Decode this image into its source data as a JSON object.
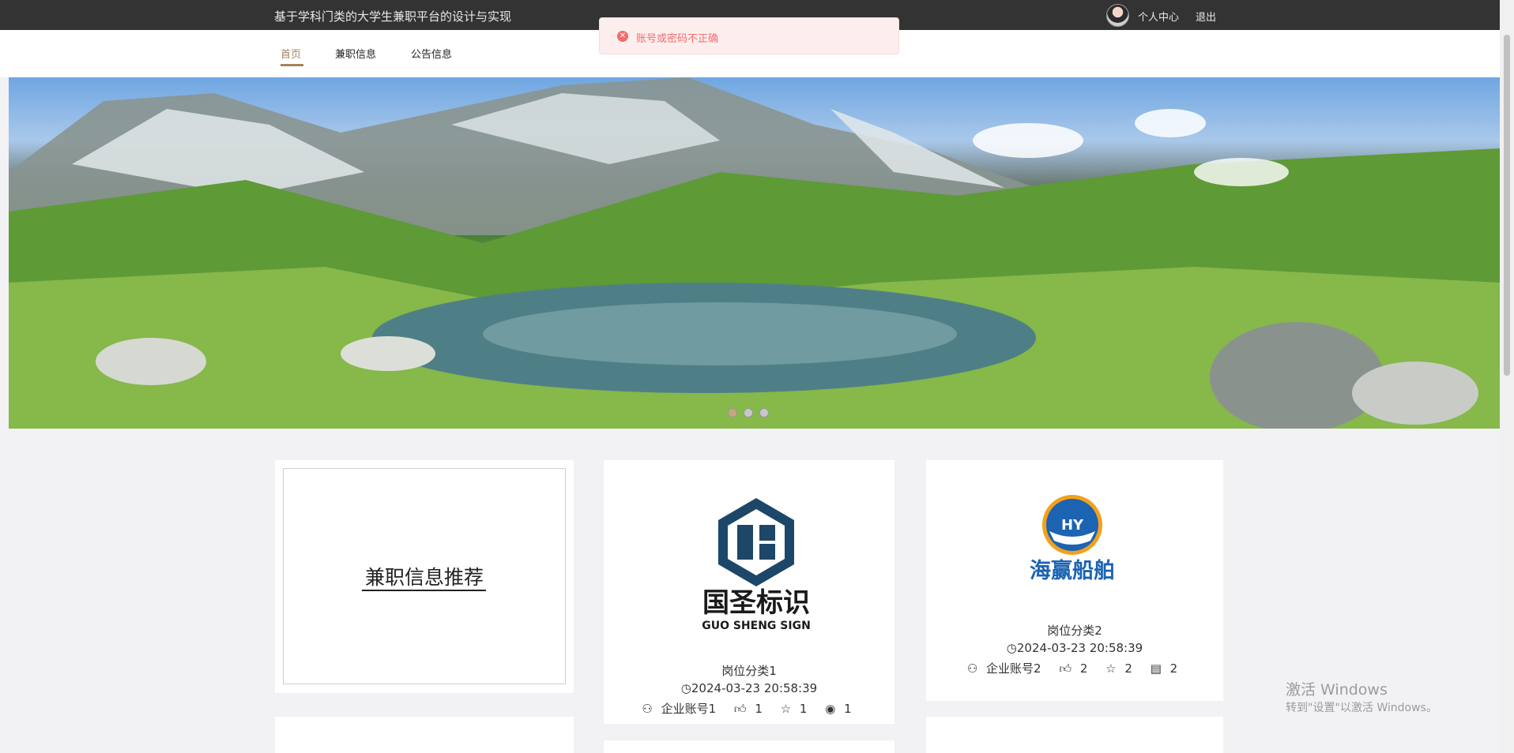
{
  "header": {
    "site_title": "基于学科门类的大学生兼职平台的设计与实现",
    "profile_label": "个人中心",
    "logout_label": "退出"
  },
  "nav": {
    "items": [
      {
        "label": "首页",
        "active": true
      },
      {
        "label": "兼职信息",
        "active": false
      },
      {
        "label": "公告信息",
        "active": false
      }
    ]
  },
  "toast": {
    "icon": "close-circle-icon",
    "message": "账号或密码不正确",
    "color": "#f56c6c"
  },
  "carousel": {
    "slides": 3,
    "active_index": 0
  },
  "recommend": {
    "title": "兼职信息推荐"
  },
  "jobs": [
    {
      "logo_text": "国圣标识",
      "logo_sub": "GUO SHENG SIGN",
      "category": "岗位分类1",
      "time": "2024-03-23 20:58:39",
      "account": "企业账号1",
      "likes": "1",
      "favorites": "1",
      "views": "1"
    },
    {
      "logo_text": "海赢船舶",
      "logo_sub": "HY",
      "category": "岗位分类2",
      "time": "2024-03-23 20:58:39",
      "account": "企业账号2",
      "likes": "2",
      "favorites": "2",
      "comments": "2"
    }
  ],
  "watermark": {
    "title": "激活 Windows",
    "subtitle": "转到\"设置\"以激活 Windows。"
  },
  "colors": {
    "topbar": "#333333",
    "accent": "#a0865c"
  }
}
